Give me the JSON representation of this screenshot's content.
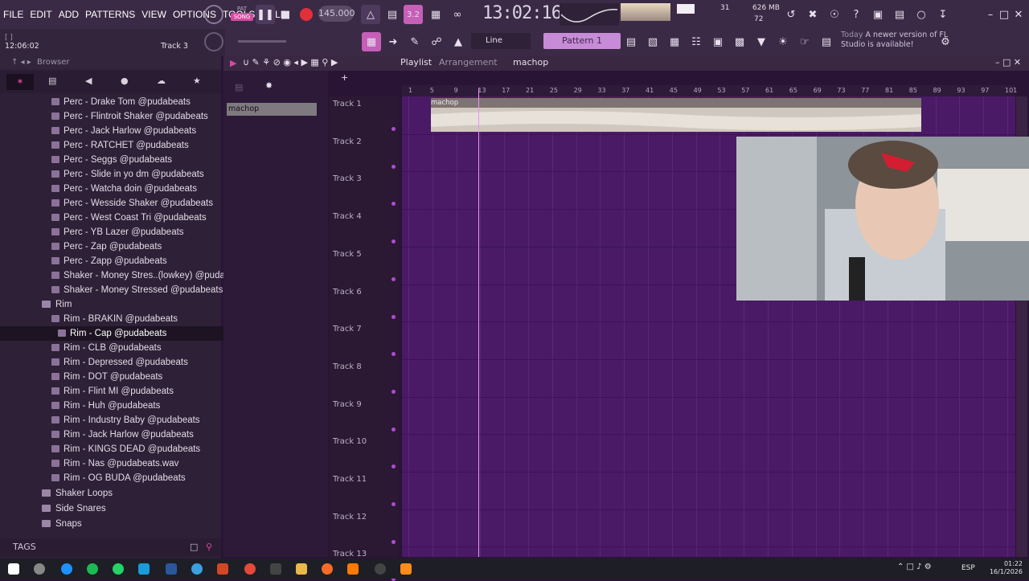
{
  "menu": [
    "FILE",
    "EDIT",
    "ADD",
    "PATTERNS",
    "VIEW",
    "OPTIONS",
    "TOOLS",
    "HELP"
  ],
  "transport": {
    "pat_label": "PAT",
    "song_label": "SONG",
    "tempo": "145.000",
    "time": "13:02:16",
    "snap_value": "3.2",
    "cpu_value": "31",
    "memory": "626 MB",
    "voices": "72"
  },
  "hint": {
    "time": "12:06:02",
    "track": "Track 3"
  },
  "toolbar2": {
    "snap_mode": "Line",
    "pattern": "Pattern 1"
  },
  "news": {
    "prefix": "Today",
    "text": "A newer version of FL Studio is available!"
  },
  "browser": {
    "title": "Browser",
    "items": [
      "Perc - Drake Tom @pudabeats",
      "Perc - Flintroit Shaker @pudabeats",
      "Perc - Jack Harlow @pudabeats",
      "Perc - RATCHET @pudabeats",
      "Perc - Seggs @pudabeats",
      "Perc - Slide in yo dm @pudabeats",
      "Perc - Watcha doin @pudabeats",
      "Perc - Wesside Shaker @pudabeats",
      "Perc - West Coast Tri @pudabeats",
      "Perc - YB Lazer @pudabeats",
      "Perc - Zap @pudabeats",
      "Perc - Zapp @pudabeats",
      "Shaker - Money Stres..(lowkey) @pudabeats",
      "Shaker - Money Stressed @pudabeats"
    ],
    "folder_rim": "Rim",
    "rim_items": [
      "Rim - BRAKIN @pudabeats",
      "Rim - Cap @pudabeats",
      "Rim - CLB @pudabeats",
      "Rim - Depressed @pudabeats",
      "Rim - DOT @pudabeats",
      "Rim - Flint MI @pudabeats",
      "Rim - Huh @pudabeats",
      "Rim - Industry Baby @pudabeats",
      "Rim - Jack Harlow @pudabeats",
      "Rim - KINGS DEAD @pudabeats",
      "Rim - Nas @pudabeats.wav",
      "Rim - OG BUDA @pudabeats"
    ],
    "folders": [
      "Shaker Loops",
      "Side Snares",
      "Snaps"
    ],
    "tags_label": "TAGS"
  },
  "playlist": {
    "title": "Playlist",
    "subtitle": "Arrangement",
    "pattern_name": "machop",
    "channel_item": "machop",
    "clip_label": "machop",
    "ruler": [
      "1",
      "5",
      "9",
      "13",
      "17",
      "21",
      "25",
      "29",
      "33",
      "37",
      "41",
      "45",
      "49",
      "53",
      "57",
      "61",
      "65",
      "69",
      "73",
      "77",
      "81",
      "85",
      "89",
      "93",
      "97",
      "101"
    ],
    "tracks": [
      "Track 1",
      "Track 2",
      "Track 3",
      "Track 4",
      "Track 5",
      "Track 6",
      "Track 7",
      "Track 8",
      "Track 9",
      "Track 10",
      "Track 11",
      "Track 12",
      "Track 13"
    ]
  },
  "taskbar": {
    "lang": "ESP",
    "time": "01:22",
    "date": "16/1/2026"
  },
  "colors": {
    "grid": "#4a1a66",
    "accent": "#d64aa0",
    "playhead": "#e39af2"
  }
}
